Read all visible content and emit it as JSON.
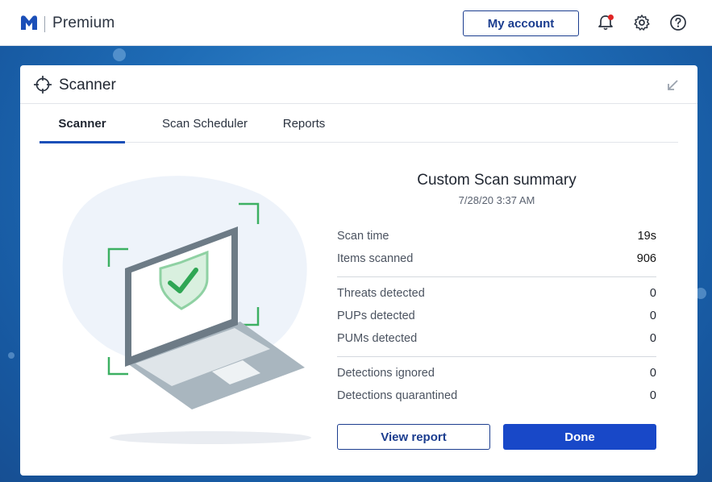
{
  "app": {
    "brand": "Premium",
    "logo_icon": "malwarebytes-logo-icon"
  },
  "topbar": {
    "my_account_label": "My account",
    "notification_icon": "bell-icon",
    "settings_icon": "gear-icon",
    "help_icon": "help-icon"
  },
  "card": {
    "title": "Scanner",
    "title_icon": "crosshair-icon",
    "collapse_icon": "collapse-arrow-icon"
  },
  "tabs": [
    {
      "label": "Scanner",
      "active": true
    },
    {
      "label": "Scan Scheduler",
      "active": false
    },
    {
      "label": "Reports",
      "active": false
    }
  ],
  "summary": {
    "title": "Custom Scan summary",
    "date": "7/28/20 3:37 AM",
    "rows": [
      {
        "label": "Scan time",
        "value": "19s"
      },
      {
        "label": "Items scanned",
        "value": "906"
      },
      {
        "label": "Threats detected",
        "value": "0"
      },
      {
        "label": "PUPs detected",
        "value": "0"
      },
      {
        "label": "PUMs detected",
        "value": "0"
      },
      {
        "label": "Detections ignored",
        "value": "0"
      },
      {
        "label": "Detections quarantined",
        "value": "0"
      }
    ]
  },
  "buttons": {
    "view_report": "View report",
    "done": "Done"
  },
  "colors": {
    "accent": "#1848c8",
    "outline": "#1b3d8f",
    "shield_green": "#3cb062",
    "notification_dot": "#e02424"
  }
}
